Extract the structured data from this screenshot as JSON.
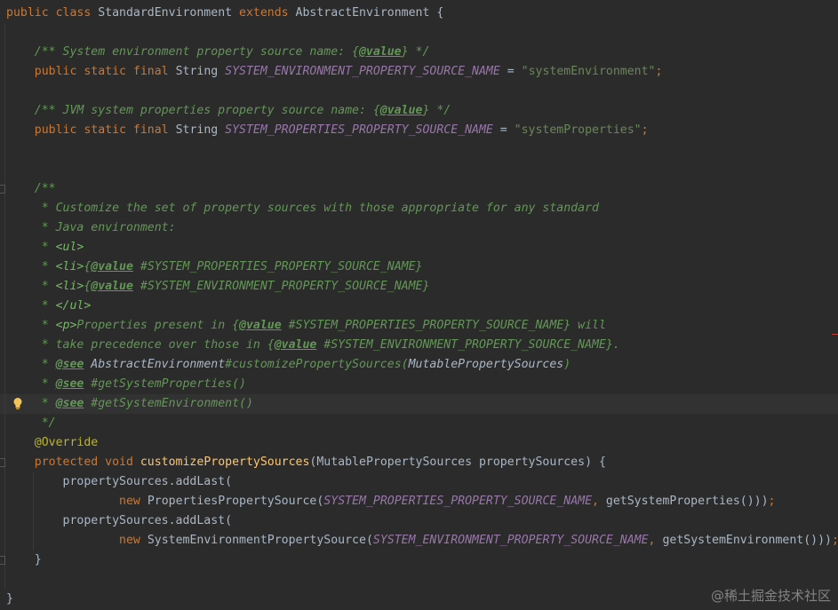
{
  "editor": {
    "watermark": "@稀土掘金技术社区",
    "theme_colors": {
      "background": "#2b2b2b",
      "keyword": "#cc7832",
      "string": "#6a8759",
      "constant": "#9876aa",
      "doc_comment": "#629755",
      "method": "#ffc66d",
      "annotation": "#bbb529"
    },
    "lines": [
      [
        {
          "t": "public class ",
          "c": "kw"
        },
        {
          "t": "StandardEnvironment ",
          "c": "cl"
        },
        {
          "t": "extends ",
          "c": "kw"
        },
        {
          "t": "AbstractEnvironment {",
          "c": "cl"
        }
      ],
      [],
      [
        {
          "t": "    /** System environment property source name: {",
          "c": "dc"
        },
        {
          "t": "@value",
          "c": "dt"
        },
        {
          "t": "} */",
          "c": "dc"
        }
      ],
      [
        {
          "t": "    public static final ",
          "c": "kw"
        },
        {
          "t": "String ",
          "c": "cl"
        },
        {
          "t": "SYSTEM_ENVIRONMENT_PROPERTY_SOURCE_NAME",
          "c": "cn"
        },
        {
          "t": " = ",
          "c": "cl"
        },
        {
          "t": "\"systemEnvironment\"",
          "c": "st"
        },
        {
          "t": ";",
          "c": "kw"
        }
      ],
      [],
      [
        {
          "t": "    /** JVM system properties property source name: {",
          "c": "dc"
        },
        {
          "t": "@value",
          "c": "dt"
        },
        {
          "t": "} */",
          "c": "dc"
        }
      ],
      [
        {
          "t": "    public static final ",
          "c": "kw"
        },
        {
          "t": "String ",
          "c": "cl"
        },
        {
          "t": "SYSTEM_PROPERTIES_PROPERTY_SOURCE_NAME",
          "c": "cn"
        },
        {
          "t": " = ",
          "c": "cl"
        },
        {
          "t": "\"systemProperties\"",
          "c": "st"
        },
        {
          "t": ";",
          "c": "kw"
        }
      ],
      [],
      [],
      [
        {
          "t": "    /**",
          "c": "dc"
        }
      ],
      [
        {
          "t": "     * Customize the set of property sources with those appropriate for any standard",
          "c": "dc"
        }
      ],
      [
        {
          "t": "     * Java environment:",
          "c": "dc"
        }
      ],
      [
        {
          "t": "     * ",
          "c": "dc"
        },
        {
          "t": "<ul>",
          "c": "dh"
        }
      ],
      [
        {
          "t": "     * ",
          "c": "dc"
        },
        {
          "t": "<li>",
          "c": "dh"
        },
        {
          "t": "{",
          "c": "dc"
        },
        {
          "t": "@value",
          "c": "dt"
        },
        {
          "t": " #SYSTEM_PROPERTIES_PROPERTY_SOURCE_NAME}",
          "c": "dc"
        }
      ],
      [
        {
          "t": "     * ",
          "c": "dc"
        },
        {
          "t": "<li>",
          "c": "dh"
        },
        {
          "t": "{",
          "c": "dc"
        },
        {
          "t": "@value",
          "c": "dt"
        },
        {
          "t": " #SYSTEM_ENVIRONMENT_PROPERTY_SOURCE_NAME}",
          "c": "dc"
        }
      ],
      [
        {
          "t": "     * ",
          "c": "dc"
        },
        {
          "t": "</ul>",
          "c": "dh"
        }
      ],
      [
        {
          "t": "     * ",
          "c": "dc"
        },
        {
          "t": "<p>",
          "c": "dh"
        },
        {
          "t": "Properties present in {",
          "c": "dc"
        },
        {
          "t": "@value",
          "c": "dt"
        },
        {
          "t": " #SYSTEM_PROPERTIES_PROPERTY_SOURCE_NAME} will",
          "c": "dc"
        }
      ],
      [
        {
          "t": "     * take precedence over those in {",
          "c": "dc"
        },
        {
          "t": "@value",
          "c": "dt"
        },
        {
          "t": " #SYSTEM_ENVIRONMENT_PROPERTY_SOURCE_NAME}.",
          "c": "dc"
        }
      ],
      [
        {
          "t": "     * ",
          "c": "dc"
        },
        {
          "t": "@see",
          "c": "dt"
        },
        {
          "t": " AbstractEnvironment",
          "c": "dl"
        },
        {
          "t": "#customizePropertySources(",
          "c": "dc"
        },
        {
          "t": "MutablePropertySources",
          "c": "dl"
        },
        {
          "t": ")",
          "c": "dc"
        }
      ],
      [
        {
          "t": "     * ",
          "c": "dc"
        },
        {
          "t": "@see",
          "c": "dt"
        },
        {
          "t": " #getSystemProperties()",
          "c": "dc"
        }
      ],
      [
        {
          "t": "     * ",
          "c": "dc"
        },
        {
          "t": "@see",
          "c": "dt"
        },
        {
          "t": " #getSystemEnvironment()",
          "c": "dc"
        }
      ],
      [
        {
          "t": "     */",
          "c": "dc"
        }
      ],
      [
        {
          "t": "    @Override",
          "c": "an"
        }
      ],
      [
        {
          "t": "    protected void ",
          "c": "kw"
        },
        {
          "t": "customizePropertySources",
          "c": "fn"
        },
        {
          "t": "(MutablePropertySources propertySources) {",
          "c": "cl"
        }
      ],
      [
        {
          "t": "        propertySources.addLast(",
          "c": "cl"
        }
      ],
      [
        {
          "t": "                ",
          "c": "cl"
        },
        {
          "t": "new ",
          "c": "kw"
        },
        {
          "t": "PropertiesPropertySource(",
          "c": "cl"
        },
        {
          "t": "SYSTEM_PROPERTIES_PROPERTY_SOURCE_NAME",
          "c": "cn"
        },
        {
          "t": ", ",
          "c": "kw"
        },
        {
          "t": "getSystemProperties()))",
          "c": "cl"
        },
        {
          "t": ";",
          "c": "kw"
        }
      ],
      [
        {
          "t": "        propertySources.addLast(",
          "c": "cl"
        }
      ],
      [
        {
          "t": "                ",
          "c": "cl"
        },
        {
          "t": "new ",
          "c": "kw"
        },
        {
          "t": "SystemEnvironmentPropertySource(",
          "c": "cl"
        },
        {
          "t": "SYSTEM_ENVIRONMENT_PROPERTY_SOURCE_NAME",
          "c": "cn"
        },
        {
          "t": ", ",
          "c": "kw"
        },
        {
          "t": "getSystemEnvironment()))",
          "c": "cl"
        },
        {
          "t": ";",
          "c": "kw"
        }
      ],
      [
        {
          "t": "    }",
          "c": "cl"
        }
      ],
      [],
      [
        {
          "t": "}",
          "c": "cl"
        }
      ]
    ]
  }
}
